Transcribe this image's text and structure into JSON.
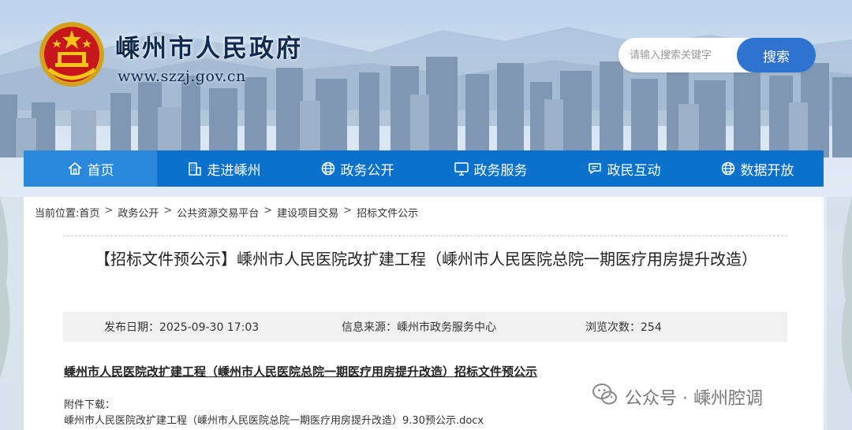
{
  "header": {
    "site_title": "嵊州市人民政府",
    "site_url": "www.szzj.gov.cn",
    "emblem_icon": "national-emblem-icon"
  },
  "search": {
    "placeholder": "请输入搜索关键字",
    "value": "",
    "button_label": "搜索"
  },
  "nav": {
    "items": [
      {
        "label": "首页",
        "icon": "home-icon",
        "active": true
      },
      {
        "label": "走进嵊州",
        "icon": "building-icon"
      },
      {
        "label": "政务公开",
        "icon": "globe-icon"
      },
      {
        "label": "政务服务",
        "icon": "monitor-icon"
      },
      {
        "label": "政民互动",
        "icon": "chat-icon"
      },
      {
        "label": "数据开放",
        "icon": "globe-icon"
      }
    ]
  },
  "breadcrumb": {
    "prefix": "当前位置:",
    "items": [
      "首页",
      "政务公开",
      "公共资源交易平台",
      "建设项目交易",
      "招标文件公示"
    ],
    "separator": ">"
  },
  "article": {
    "title": "【招标文件预公示】嵊州市人民医院改扩建工程（嵊州市人民医院总院一期医疗用房提升改造）",
    "publish_date": "发布日期：2025-09-30 17:03",
    "source": "信息来源：嵊州市政务服务中心",
    "views": "浏览次数：254",
    "heading": "嵊州市人民医院改扩建工程（嵊州市人民医院总院一期医疗用房提升改造）招标文件预公示",
    "attachment_label": "附件下载：",
    "attachment_file": "嵊州市人民医院改扩建工程（嵊州市人民医院总院一期医疗用房提升改造）9.30预公示.docx"
  },
  "watermark": {
    "text": "公众号 · 嵊州腔调",
    "icon": "wechat-icon"
  },
  "colors": {
    "nav_bg": "#0a72cd",
    "nav_active_bg": "#2a89dc",
    "search_button": "#2f73d0",
    "title_text": "#0e2b4f"
  }
}
